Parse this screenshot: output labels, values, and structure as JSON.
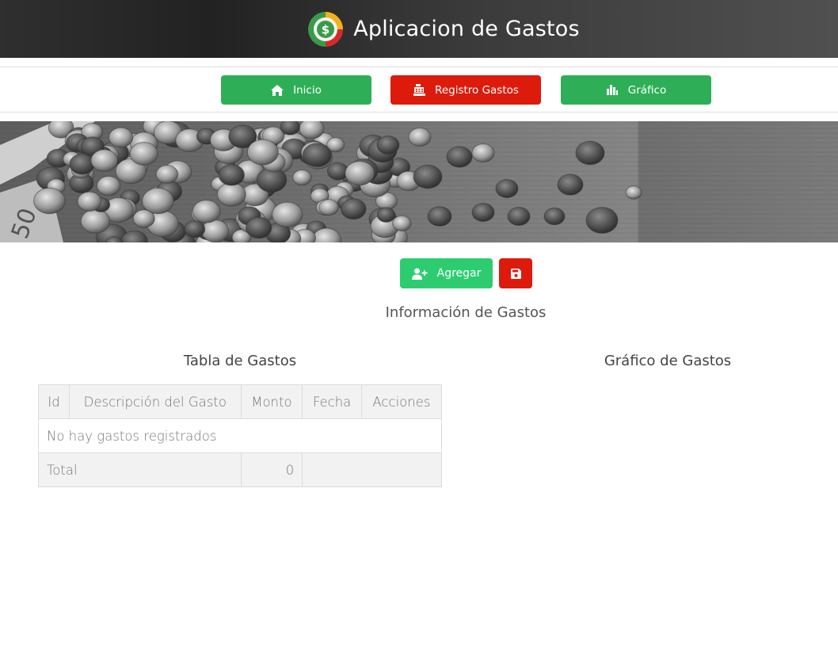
{
  "header": {
    "title": "Aplicacion de Gastos",
    "logo_icon": "dollar-coin-icon"
  },
  "nav": {
    "items": [
      {
        "label": "Inicio",
        "icon": "home-icon",
        "color": "#2eaf57"
      },
      {
        "label": "Registro Gastos",
        "icon": "cash-register-icon",
        "color": "#dc1b0c"
      },
      {
        "label": "Gráfico",
        "icon": "bar-chart-icon",
        "color": "#2eaf57"
      }
    ]
  },
  "actions": {
    "add_label": "Agregar",
    "add_icon": "user-plus-icon",
    "save_icon": "floppy-disk-icon"
  },
  "section": {
    "title": "Información de Gastos",
    "table_title": "Tabla de Gastos",
    "chart_title": "Gráfico de Gastos"
  },
  "table": {
    "columns": [
      "Id",
      "Descripción del Gasto",
      "Monto",
      "Fecha",
      "Acciones"
    ],
    "empty_message": "No hay gastos registrados",
    "total_label": "Total",
    "total_value": "0"
  },
  "colors": {
    "accent_green": "#2eaf57",
    "accent_red": "#dc1b0c",
    "add_green": "#2ecc71"
  }
}
